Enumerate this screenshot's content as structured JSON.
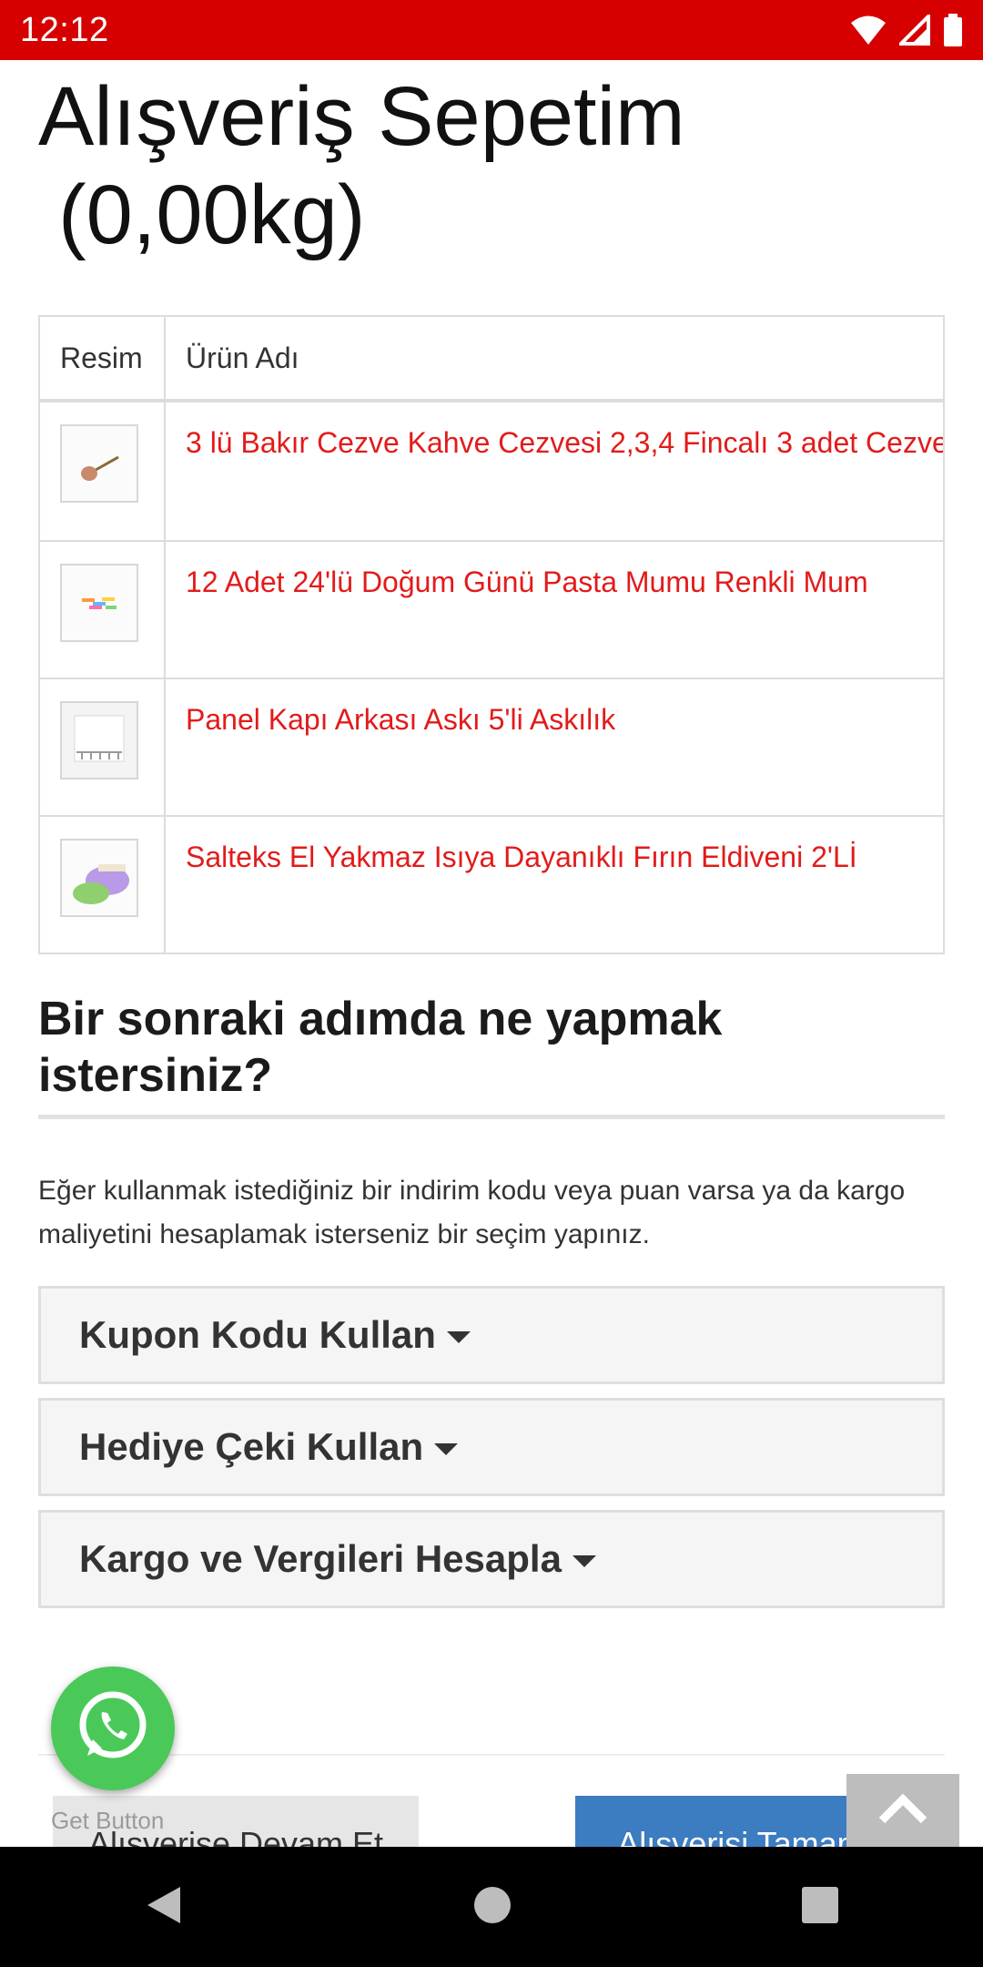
{
  "status_bar": {
    "time": "12:12"
  },
  "page": {
    "title_line1": "Alışveriş Sepetim",
    "title_line2": "(0,00kg)"
  },
  "table": {
    "headers": [
      "Resim",
      "Ürün Adı"
    ],
    "rows": [
      {
        "name": "3 lü Bakır Cezve Kahve Cezvesi 2,3,4 Fincalı 3 adet Cezve"
      },
      {
        "name": "12 Adet 24'lü Doğum Günü Pasta Mumu Renkli Mum"
      },
      {
        "name": "Panel Kapı Arkası Askı 5'li Askılık"
      },
      {
        "name": "Salteks El Yakmaz Isıya Dayanıklı Fırın Eldiveni 2'Lİ"
      }
    ]
  },
  "next_step": {
    "heading": "Bir sonraki adımda ne yapmak istersiniz?",
    "description": "Eğer kullanmak istediğiniz bir indirim kodu veya puan varsa ya da kargo maliyetini hesaplamak isterseniz bir seçim yapınız.",
    "options": [
      "Kupon Kodu Kullan",
      "Hediye Çeki Kullan",
      "Kargo ve Vergileri Hesapla"
    ]
  },
  "actions": {
    "continue_label": "Alışverişe Devam Et",
    "checkout_label": "Alışverişi Tamamla",
    "get_button_label": "Get Button"
  },
  "colors": {
    "status_bar": "#d60000",
    "link": "#e21b1b",
    "checkout_button": "#3c7cc0",
    "whatsapp": "#4ac959"
  },
  "icons": [
    "wifi-icon",
    "signal-icon",
    "battery-icon",
    "whatsapp-icon",
    "chevron-up-icon",
    "back-icon",
    "home-icon",
    "recents-icon"
  ]
}
